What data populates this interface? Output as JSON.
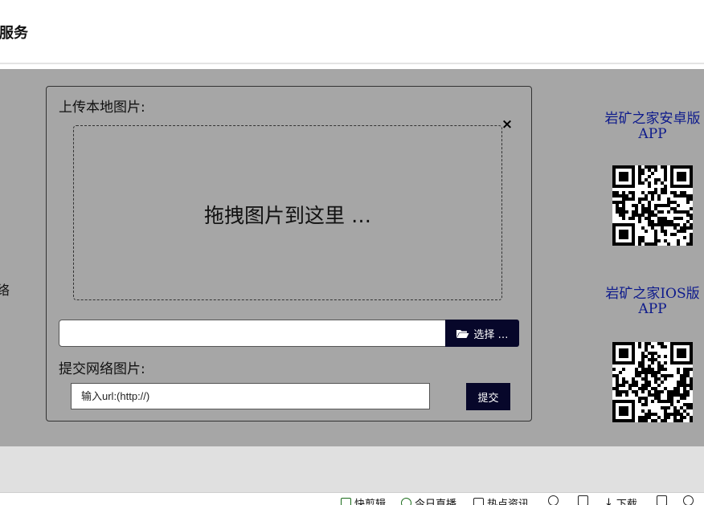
{
  "header": {
    "title": "服务"
  },
  "left_fragment": "络",
  "upload": {
    "local_label": "上传本地图片:",
    "close_symbol": "×",
    "drop_text": "拖拽图片到这里 …",
    "file_value": "",
    "choose_label": "选择 …",
    "net_label": "提交网络图片:",
    "url_value": "输入url:(http://)",
    "submit_label": "提交"
  },
  "apps": {
    "android_title_line1": "岩矿之家安卓版",
    "android_title_line2": "APP",
    "ios_title_line1": "岩矿之家IOS版",
    "ios_title_line2": "APP"
  },
  "taskbar": {
    "items": [
      {
        "icon": "play-icon",
        "label": "快剪辑"
      },
      {
        "icon": "live-icon",
        "label": "今日直播"
      },
      {
        "icon": "news-icon",
        "label": "热点资讯"
      },
      {
        "icon": "refresh-icon",
        "label": ""
      },
      {
        "icon": "pin-icon",
        "label": ""
      },
      {
        "icon": "download-icon",
        "label": "下载"
      },
      {
        "icon": "window-icon",
        "label": ""
      },
      {
        "icon": "share-icon",
        "label": ""
      }
    ]
  },
  "colors": {
    "overlay": "#a6a6a6",
    "button_bg": "#07072a",
    "app_title": "#0d1a8c"
  }
}
